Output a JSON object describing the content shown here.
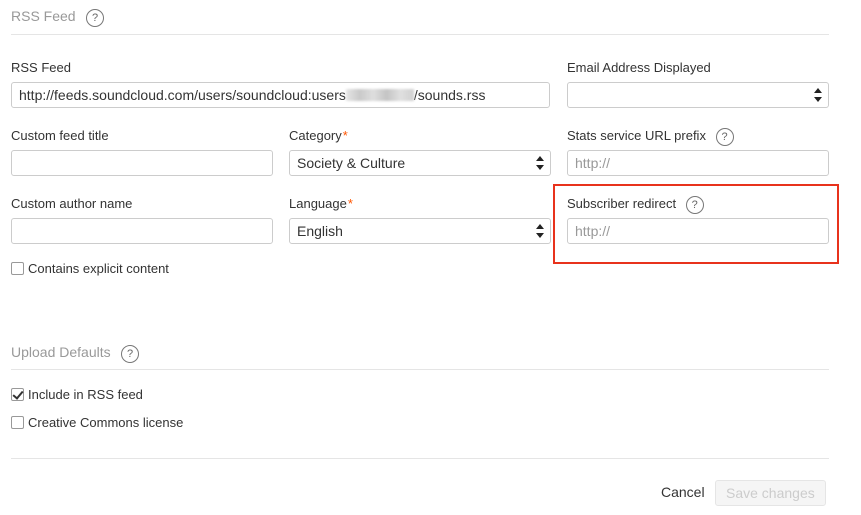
{
  "rss_section": {
    "title": "RSS Feed",
    "help": "?"
  },
  "fields": {
    "rss_feed": {
      "label": "RSS Feed",
      "value_prefix": "http://feeds.soundcloud.com/users/soundcloud:users",
      "value_suffix": "/sounds.rss"
    },
    "email": {
      "label": "Email Address Displayed",
      "value": ""
    },
    "custom_title": {
      "label": "Custom feed title",
      "value": ""
    },
    "category": {
      "label": "Category",
      "required": "*",
      "value": "Society & Culture"
    },
    "stats_prefix": {
      "label": "Stats service URL prefix",
      "help": "?",
      "placeholder": "http://"
    },
    "custom_author": {
      "label": "Custom author name",
      "value": ""
    },
    "language": {
      "label": "Language",
      "required": "*",
      "value": "English"
    },
    "subscriber_redirect": {
      "label": "Subscriber redirect",
      "help": "?",
      "placeholder": "http://"
    },
    "explicit": {
      "label": "Contains explicit content",
      "checked": false
    }
  },
  "upload_section": {
    "title": "Upload Defaults",
    "help": "?"
  },
  "upload": {
    "include_rss": {
      "label": "Include in RSS feed",
      "checked": true
    },
    "creative_commons": {
      "label": "Creative Commons license",
      "checked": false
    }
  },
  "footer": {
    "cancel": "Cancel",
    "save": "Save changes"
  },
  "colors": {
    "required": "#ff5500",
    "highlight": "#e8321c",
    "placeholder": "#999999"
  }
}
